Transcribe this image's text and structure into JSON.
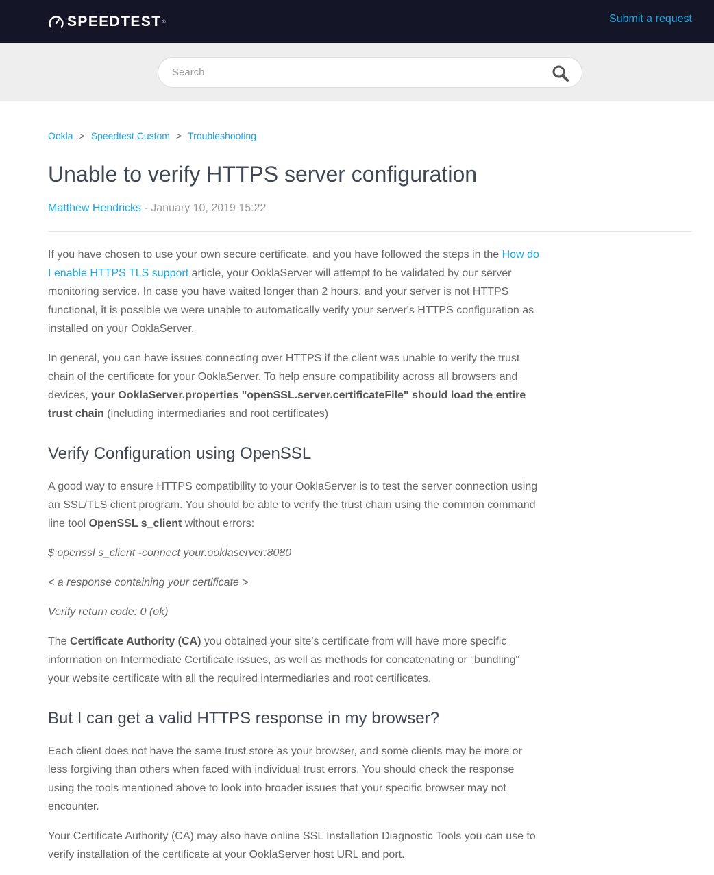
{
  "header": {
    "logo_text": "SPEEDTEST",
    "logo_tm": "®",
    "submit_request": "Submit a request"
  },
  "search": {
    "placeholder": "Search",
    "value": ""
  },
  "breadcrumb": {
    "items": [
      "Ookla",
      "Speedtest Custom",
      "Troubleshooting"
    ],
    "separator": ">"
  },
  "article": {
    "title": "Unable to verify HTTPS server configuration",
    "author": "Matthew Hendricks",
    "date_sep": " - ",
    "date": "January 10, 2019 15:22",
    "p1_a": "If you have chosen to use your own secure certificate, and you have followed the steps in the ",
    "p1_link": "How do I enable HTTPS TLS support",
    "p1_b": " article, your OoklaServer will attempt to be validated by our server monitoring service.  In case you have waited longer than 2 hours, and your server is not HTTPS functional, it is possible we were unable to automatically verify your server's HTTPS configuration as installed on your OoklaServer.",
    "p2_a": "In general, you can have issues connecting over HTTPS if the client was unable to verify the trust chain of the certificate for your OoklaServer. To help ensure compatibility across all browsers and devices, ",
    "p2_bold": "your OoklaServer.properties \"openSSL.server.certificateFile\" should load the entire trust chain",
    "p2_b": " (including intermediaries and root certificates)",
    "h2_1": "Verify Configuration using OpenSSL",
    "p3_a": "A good way to ensure HTTPS compatibility to your OoklaServer is to test the server connection using an SSL/TLS client program. You should be able to verify the trust chain using the common command line tool ",
    "p3_bold": "OpenSSL s_client",
    "p3_b": " without errors:",
    "code1": "$ openssl s_client -connect your.ooklaserver:8080",
    "code2": "< a response containing your certificate >",
    "code3": "Verify return code: 0 (ok)",
    "p4_a": "The ",
    "p4_bold": "Certificate Authority (CA)",
    "p4_b": " you obtained your site's certificate from will have more specific information on Intermediate Certificate issues, as well as methods for concatenating or \"bundling\" your website certificate with all the required intermediaries and root certificates.",
    "h2_2": "But I can get a valid HTTPS response in my browser?",
    "p5": "Each client does not have the same trust store as your browser, and some clients may be more or less forgiving than others when faced with individual trust errors.  You should check the response using the tools mentioned above to look into broader issues that your specific browser may not encounter.",
    "p6": "Your Certificate Authority (CA) may also have online SSL Installation Diagnostic Tools you can use to verify installation of the certificate at your OoklaServer host URL and port."
  },
  "icons": {
    "logo": "speedometer-icon",
    "search": "search-icon"
  },
  "colors": {
    "header_bg": "#141526",
    "link": "#1da7e0",
    "search_band": "#eeeeee",
    "heading": "#414854",
    "body_text": "#666666"
  }
}
